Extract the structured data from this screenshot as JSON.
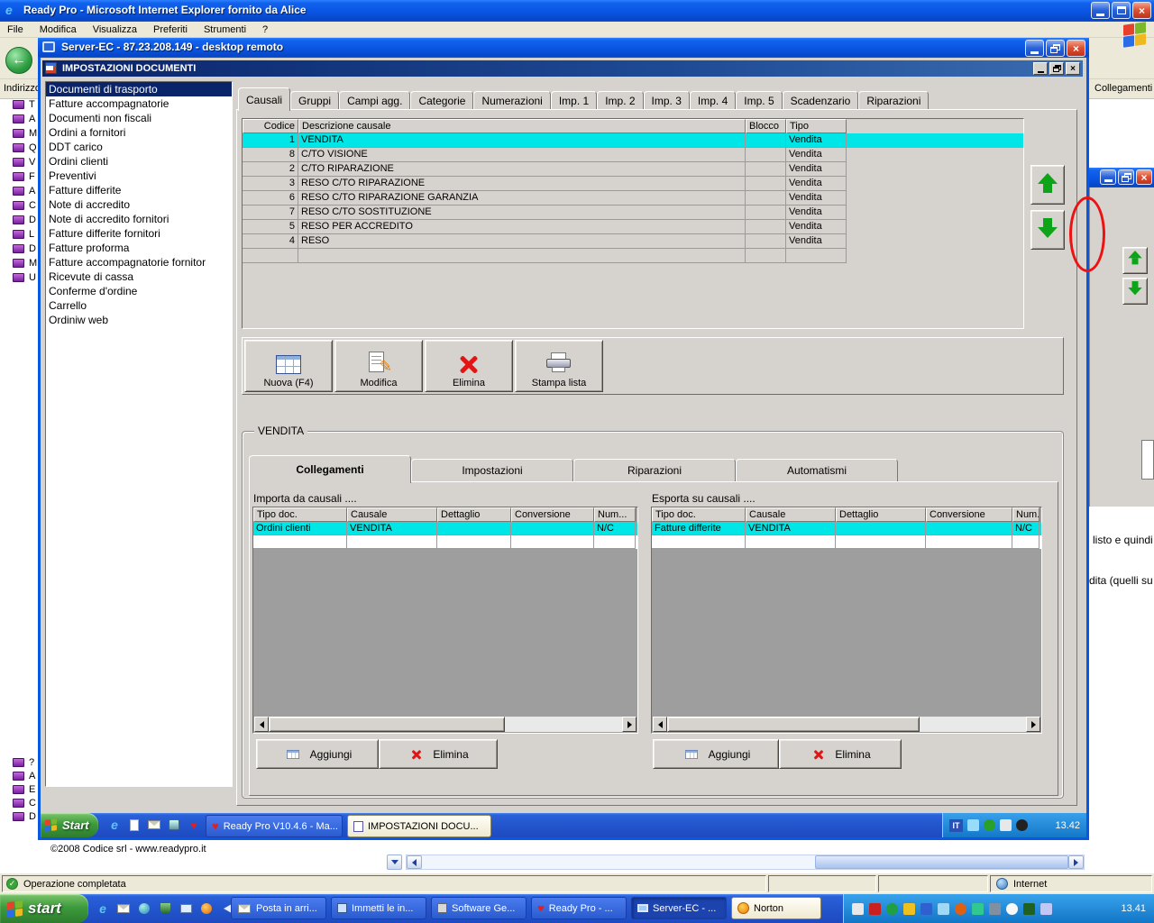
{
  "glyphs": {
    "ie_e": "e",
    "back_arrow": "←",
    "heart": "♥",
    "check": "✓",
    "pencil": "✎",
    "close": "×",
    "question": "?"
  },
  "ie": {
    "title": "Ready Pro - Microsoft Internet Explorer fornito da Alice",
    "menu": [
      "File",
      "Modifica",
      "Visualizza",
      "Preferiti",
      "Strumenti",
      "?"
    ],
    "address_label": "Indirizzo",
    "links_label": "Collegamenti",
    "copyright": "©2008 Codice srl - www.readypro.it",
    "status_text": "Operazione completata",
    "zone_text": "Internet",
    "favorites_top": [
      "T",
      "A",
      "M",
      "Q",
      "V",
      "F",
      "A",
      "C",
      "D",
      "L",
      "D",
      "M",
      "U"
    ],
    "favorites_bottom": [
      "?",
      "A",
      "E",
      "C",
      "D"
    ],
    "page_fragments": {
      "line1": "listo e quindi",
      "line2": "dita (quelli su"
    }
  },
  "remote": {
    "title": "Server-EC - 87.23.208.149 - desktop remoto",
    "taskbar": {
      "start_label": "Start",
      "task_readypro": "Ready Pro V10.4.6 - Ma...",
      "task_impostazioni": "IMPOSTAZIONI DOCU...",
      "lang_indicator": "IT",
      "clock": "13.42"
    }
  },
  "app": {
    "title": "IMPOSTAZIONI DOCUMENTI",
    "doc_types": [
      "Documenti di trasporto",
      "Fatture accompagnatorie",
      "Documenti non fiscali",
      "Ordini a fornitori",
      "DDT carico",
      "Ordini clienti",
      "Preventivi",
      "Fatture differite",
      "Note di accredito",
      "Note di accredito fornitori",
      "Fatture differite fornitori",
      "Fatture proforma",
      "Fatture accompagnatorie fornitor",
      "Ricevute di cassa",
      "Conferme d'ordine",
      "Carrello",
      "Ordiniw web"
    ],
    "tabs": [
      "Causali",
      "Gruppi",
      "Campi agg.",
      "Categorie",
      "Numerazioni",
      "Imp. 1",
      "Imp. 2",
      "Imp. 3",
      "Imp. 4",
      "Imp. 5",
      "Scadenzario",
      "Riparazioni"
    ],
    "grid": {
      "headers": [
        "Codice",
        "Descrizione causale",
        "Blocco",
        "Tipo"
      ],
      "rows": [
        [
          "1",
          "VENDITA",
          "",
          "Vendita"
        ],
        [
          "8",
          "C/TO VISIONE",
          "",
          "Vendita"
        ],
        [
          "2",
          "C/TO RIPARAZIONE",
          "",
          "Vendita"
        ],
        [
          "3",
          "RESO C/TO RIPARAZIONE",
          "",
          "Vendita"
        ],
        [
          "6",
          "RESO C/TO RIPARAZIONE GARANZIA",
          "",
          "Vendita"
        ],
        [
          "7",
          "RESO C/TO SOSTITUZIONE",
          "",
          "Vendita"
        ],
        [
          "5",
          "RESO PER ACCREDITO",
          "",
          "Vendita"
        ],
        [
          "4",
          "RESO",
          "",
          "Vendita"
        ]
      ]
    },
    "toolbar": {
      "new_label": "Nuova (F4)",
      "edit_label": "Modifica",
      "delete_label": "Elimina",
      "print_label": "Stampa lista"
    },
    "group": {
      "title": "VENDITA",
      "tabs": [
        "Collegamenti",
        "Impostazioni",
        "Riparazioni",
        "Automatismi"
      ],
      "import": {
        "label": "Importa da causali ....",
        "headers": [
          "Tipo doc.",
          "Causale",
          "Dettaglio",
          "Conversione",
          "Num..."
        ],
        "row": [
          "Ordini clienti",
          "VENDITA",
          "",
          "",
          "N/C"
        ],
        "add_label": "Aggiungi",
        "delete_label": "Elimina"
      },
      "export": {
        "label": "Esporta su causali ....",
        "headers": [
          "Tipo doc.",
          "Causale",
          "Dettaglio",
          "Conversione",
          "Num..."
        ],
        "row": [
          "Fatture differite",
          "VENDITA",
          "",
          "",
          "N/C"
        ],
        "add_label": "Aggiungi",
        "delete_label": "Elimina"
      }
    }
  },
  "xp_taskbar": {
    "start_label": "start",
    "tasks": [
      "Posta in arri...",
      "Immetti le in...",
      "Software Ge...",
      "Ready Pro - ...",
      "Server-EC - ...",
      "Norton"
    ],
    "clock": "13.41"
  }
}
